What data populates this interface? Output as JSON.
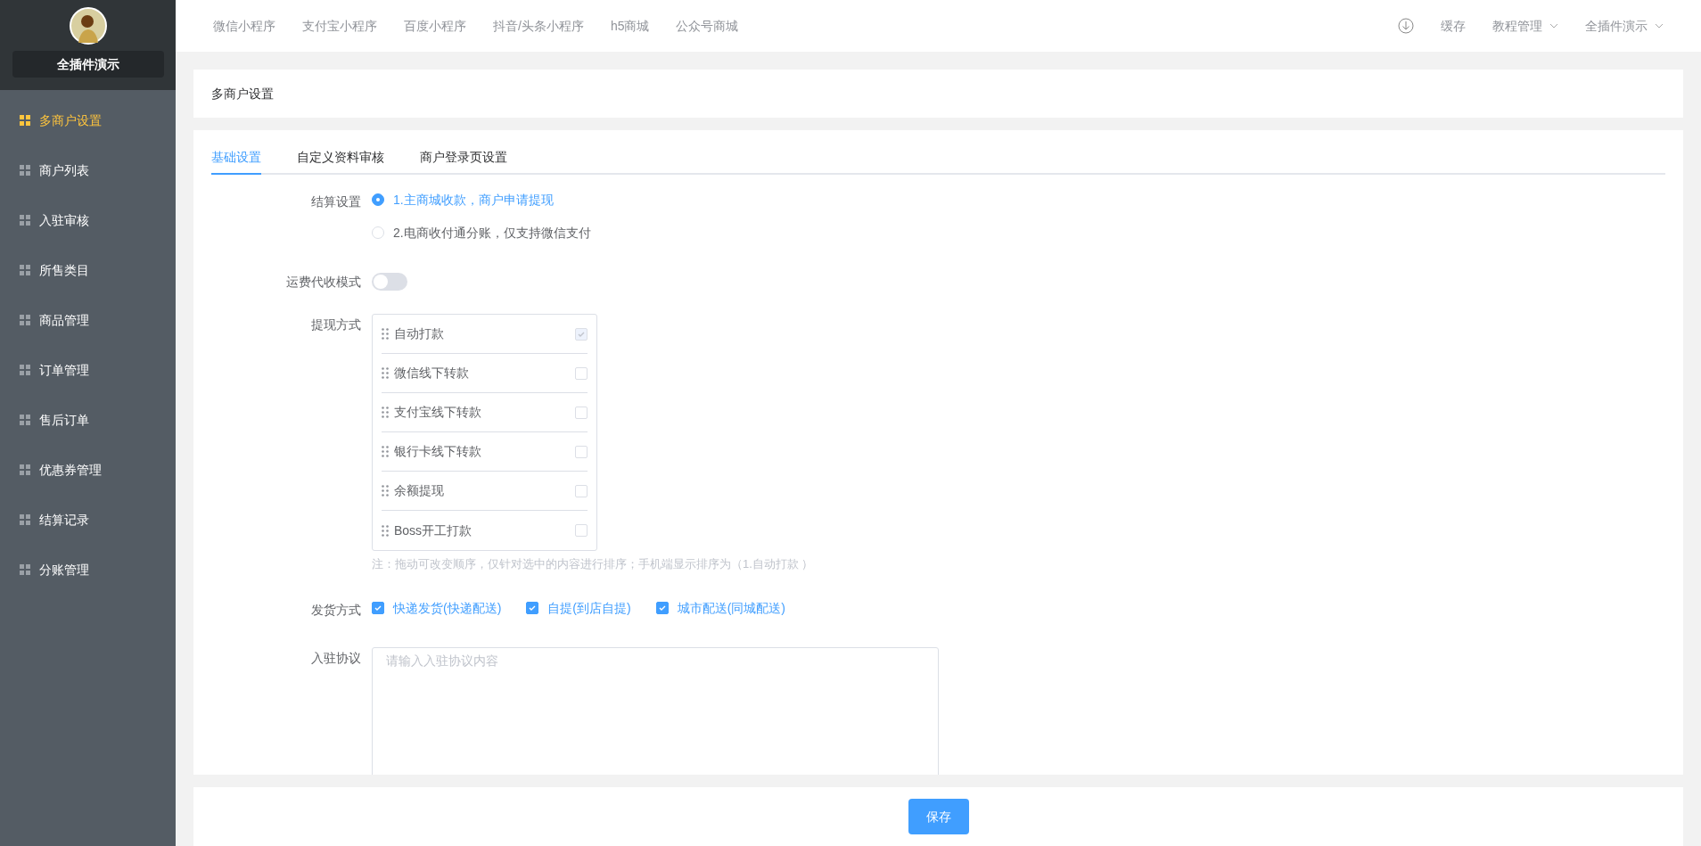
{
  "sidebar": {
    "title": "全插件演示",
    "items": [
      {
        "label": "多商户设置",
        "selected": true
      },
      {
        "label": "商户列表",
        "selected": false
      },
      {
        "label": "入驻审核",
        "selected": false
      },
      {
        "label": "所售类目",
        "selected": false
      },
      {
        "label": "商品管理",
        "selected": false
      },
      {
        "label": "订单管理",
        "selected": false
      },
      {
        "label": "售后订单",
        "selected": false
      },
      {
        "label": "优惠券管理",
        "selected": false
      },
      {
        "label": "结算记录",
        "selected": false
      },
      {
        "label": "分账管理",
        "selected": false
      }
    ]
  },
  "top_nav": {
    "links": [
      "微信小程序",
      "支付宝小程序",
      "百度小程序",
      "抖音/头条小程序",
      "h5商城",
      "公众号商城"
    ],
    "cache": "缓存",
    "menus": [
      "教程管理",
      "全插件演示"
    ]
  },
  "page_title": "多商户设置",
  "tabs": [
    {
      "label": "基础设置",
      "selected": true
    },
    {
      "label": "自定义资料审核",
      "selected": false
    },
    {
      "label": "商户登录页设置",
      "selected": false
    }
  ],
  "form": {
    "settlement": {
      "label": "结算设置",
      "options": [
        {
          "label": "1.主商城收款，商户申请提现",
          "selected": true
        },
        {
          "label": "2.电商收付通分账，仅支持微信支付",
          "selected": false
        }
      ]
    },
    "freight": {
      "label": "运费代收模式",
      "on": false
    },
    "withdraw": {
      "label": "提现方式",
      "items": [
        {
          "label": "自动打款",
          "checked": true,
          "disabled": true
        },
        {
          "label": "微信线下转款",
          "checked": false,
          "disabled": false
        },
        {
          "label": "支付宝线下转款",
          "checked": false,
          "disabled": false
        },
        {
          "label": "银行卡线下转款",
          "checked": false,
          "disabled": false
        },
        {
          "label": "余额提现",
          "checked": false,
          "disabled": false
        },
        {
          "label": "Boss开工打款",
          "checked": false,
          "disabled": false
        }
      ],
      "note": "注：拖动可改变顺序，仅针对选中的内容进行排序；手机端显示排序为（1.自动打款 ）"
    },
    "delivery": {
      "label": "发货方式",
      "options": [
        {
          "label": "快递发货(快递配送)",
          "checked": true
        },
        {
          "label": "自提(到店自提)",
          "checked": true
        },
        {
          "label": "城市配送(同城配送)",
          "checked": true
        }
      ]
    },
    "agreement": {
      "label": "入驻协议",
      "placeholder": "请输入入驻协议内容"
    }
  },
  "save_button": "保存"
}
